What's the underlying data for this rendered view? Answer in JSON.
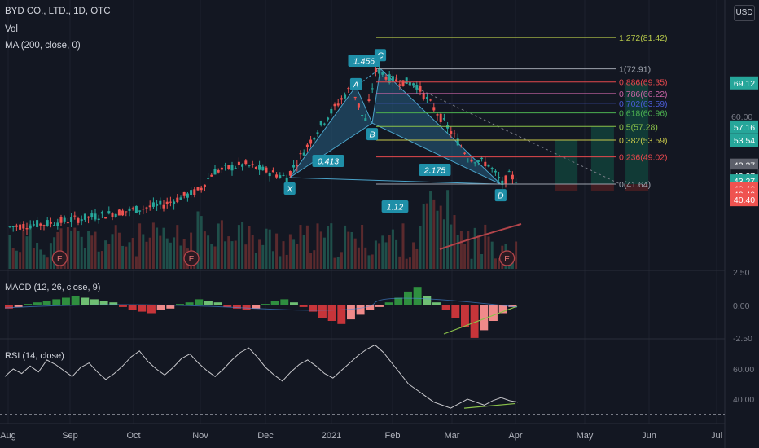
{
  "header": {
    "symbol_line": "BYD CO., LTD., 1D, OTC",
    "vol_label": "Vol",
    "ma_label": "MA (200, close, 0)",
    "currency": "USD"
  },
  "panes": {
    "macd_title": "MACD (12, 26, close, 9)",
    "rsi_title": "RSI (14, close)"
  },
  "colors": {
    "background": "#131722",
    "up": "#26a69a",
    "down": "#ef5350",
    "pattern_fill": "#2a6f97",
    "pattern_label": "#1f8fa8",
    "ma_line": "#b2444a"
  },
  "chart_data": [
    {
      "type": "candlestick",
      "title": "BYD CO., LTD., 1D, OTC",
      "y_axis_ticks": [
        "60.00"
      ],
      "x_tick_labels": [
        "Aug",
        "Sep",
        "Oct",
        "Nov",
        "Dec",
        "2021",
        "Feb",
        "Mar",
        "Apr",
        "May",
        "Jun",
        "Jul"
      ],
      "harmonic_pattern": {
        "points": [
          {
            "name": "X",
            "date": "Dec 12",
            "price": 43.4
          },
          {
            "name": "A",
            "date": "Jan 13",
            "price": 68.2
          },
          {
            "name": "B",
            "date": "Jan 21",
            "price": 58.2
          },
          {
            "name": "C",
            "date": "Jan 25",
            "price": 73.0
          },
          {
            "name": "D",
            "date": "Mar 24",
            "price": 41.6
          }
        ],
        "ratios": [
          {
            "label": "1.456"
          },
          {
            "label": "0.413"
          },
          {
            "label": "2.175"
          },
          {
            "label": "1.12"
          }
        ]
      },
      "fibonacci_levels": [
        {
          "label": "1.272(81.42)",
          "value": 81.42,
          "color": "#b5c74a"
        },
        {
          "label": "1(72.91)",
          "value": 72.91,
          "color": "#9ea3ad"
        },
        {
          "label": "0.886(69.35)",
          "value": 69.35,
          "color": "#e5484d"
        },
        {
          "label": "0.786(66.22)",
          "value": 66.22,
          "color": "#c864a6"
        },
        {
          "label": "0.702(63.59)",
          "value": 63.59,
          "color": "#4a5bd4"
        },
        {
          "label": "0.618(60.96)",
          "value": 60.96,
          "color": "#4caf50"
        },
        {
          "label": "0.5(57.28)",
          "value": 57.28,
          "color": "#8bc34a"
        },
        {
          "label": "0.382(53.59)",
          "value": 53.59,
          "color": "#c8c84a"
        },
        {
          "label": "0.236(49.02)",
          "value": 49.02,
          "color": "#e5484d"
        },
        {
          "label": "0(41.64)",
          "value": 41.64,
          "color": "#9ea3ad"
        }
      ],
      "price_badges": [
        {
          "label": "69.12",
          "value": 69.12,
          "color": "#26a69a"
        },
        {
          "label": "57.16",
          "value": 57.16,
          "color": "#26a69a"
        },
        {
          "label": "53.54",
          "value": 53.54,
          "color": "#26a69a"
        },
        {
          "label": "43.37",
          "value": 46.8,
          "color": "#5d606b"
        },
        {
          "label": "43.37",
          "value": 45.2,
          "color": "#5d606b"
        },
        {
          "label": "43.37",
          "value": 43.9,
          "color": "#131722"
        },
        {
          "label": "43.27",
          "value": 42.5,
          "color": "#26a69a"
        },
        {
          "label": "40.40",
          "value": 40.4,
          "color": "#ef5350"
        },
        {
          "label": "40.40",
          "value": 38.9,
          "color": "#ef5350"
        },
        {
          "label": "40.40",
          "value": 37.4,
          "color": "#ef5350"
        }
      ],
      "earnings_markers": [
        {
          "label": "E",
          "date": "Aug 26"
        },
        {
          "label": "E",
          "date": "Oct 27"
        },
        {
          "label": "E",
          "date": "Mar 27"
        }
      ],
      "projection_boxes": [
        {
          "date": "Apr 18",
          "top": 53.5,
          "bottom": 41.6
        },
        {
          "date": "May 4",
          "top": 57.2,
          "bottom": 41.6
        },
        {
          "date": "May 20",
          "top": 69.1,
          "bottom": 41.6
        }
      ]
    },
    {
      "type": "bar",
      "title": "MACD (12, 26, close, 9)",
      "y_ticks": [
        "2.50",
        "0.00",
        "-2.50"
      ],
      "series": [
        {
          "name": "histogram",
          "values": [
            -0.2,
            -0.1,
            0.1,
            0.2,
            0.3,
            0.4,
            0.5,
            0.6,
            0.5,
            0.4,
            0.3,
            0.2,
            -0.1,
            -0.3,
            -0.4,
            -0.5,
            -0.3,
            -0.2,
            0.1,
            0.2,
            0.4,
            0.3,
            0.2,
            -0.1,
            -0.2,
            -0.3,
            -0.2,
            0.1,
            0.3,
            0.4,
            0.2,
            -0.1,
            -0.4,
            -0.8,
            -1.0,
            -1.2,
            -0.9,
            -0.6,
            -0.3,
            -0.1,
            0.2,
            0.5,
            0.9,
            1.2,
            0.6,
            0.2,
            -0.3,
            -0.8,
            -1.4,
            -2.1,
            -1.6,
            -1.0,
            -0.5,
            -0.1
          ]
        }
      ]
    },
    {
      "type": "line",
      "title": "RSI (14, close)",
      "y_ticks": [
        "60.00",
        "40.00"
      ],
      "series": [
        {
          "name": "RSI",
          "values": [
            55,
            60,
            57,
            62,
            58,
            66,
            63,
            59,
            55,
            61,
            64,
            58,
            53,
            57,
            62,
            68,
            72,
            65,
            60,
            56,
            61,
            67,
            70,
            64,
            59,
            55,
            60,
            66,
            71,
            74,
            68,
            61,
            56,
            52,
            58,
            63,
            66,
            62,
            57,
            54,
            59,
            64,
            69,
            73,
            76,
            71,
            64,
            57,
            50,
            46,
            42,
            38,
            36,
            34,
            37,
            40,
            38,
            36,
            39,
            41,
            39,
            38
          ]
        }
      ]
    }
  ]
}
